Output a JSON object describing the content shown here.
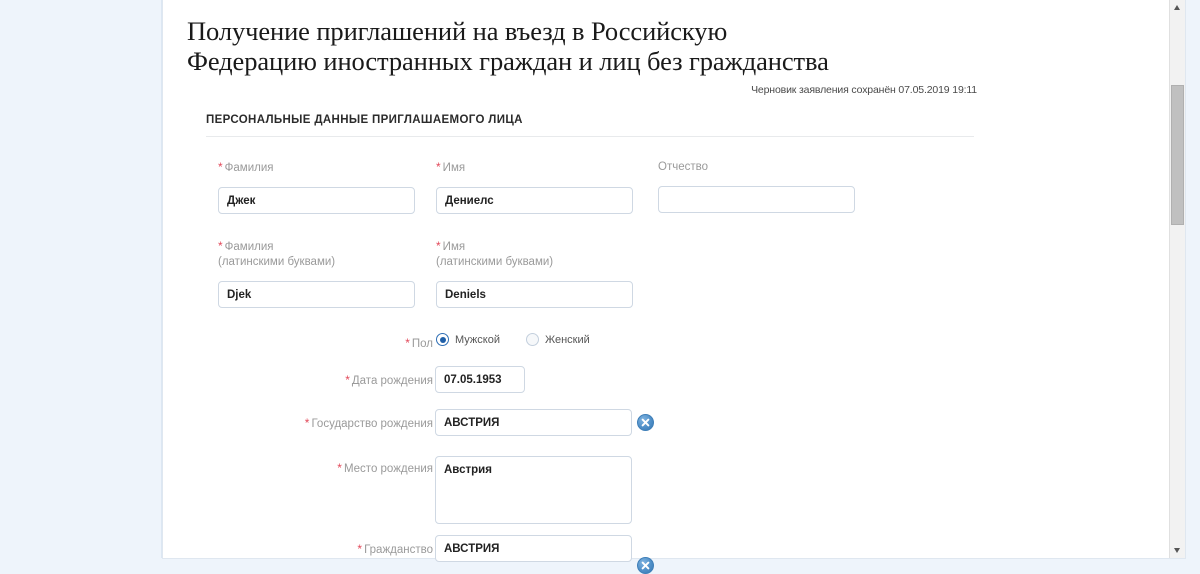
{
  "header": {
    "title": "Получение приглашений на въезд в Российскую\nФедерацию иностранных граждан и лиц без гражданства",
    "draft_note": "Черновик заявления сохранён 07.05.2019 19:11"
  },
  "section": {
    "title": "ПЕРСОНАЛЬНЫЕ ДАННЫЕ ПРИГЛАШАЕМОГО ЛИЦА"
  },
  "form": {
    "required_mark": "*",
    "surname": {
      "label": "Фамилия",
      "value": "Джек",
      "placeholder": ""
    },
    "name": {
      "label": "Имя",
      "value": "Дениелс",
      "placeholder": ""
    },
    "patronymic": {
      "label": "Отчество",
      "value": "",
      "placeholder": ""
    },
    "surname_latin": {
      "label": "Фамилия\n(латинскими буквами)",
      "value": "Djek",
      "placeholder": ""
    },
    "name_latin": {
      "label": "Имя\n(латинскими буквами)",
      "value": "Deniels",
      "placeholder": ""
    },
    "gender": {
      "label": "Пол",
      "selected": "male",
      "options": [
        {
          "id": "male",
          "label": "Мужской",
          "checked": true
        },
        {
          "id": "female",
          "label": "Женский",
          "checked": false
        }
      ]
    },
    "birth_date": {
      "label": "Дата рождения",
      "value": "07.05.1953",
      "placeholder": ""
    },
    "birth_country": {
      "label": "Государство рождения",
      "value": "АВСТРИЯ",
      "placeholder": "",
      "clear_title": "Очистить"
    },
    "birth_place": {
      "label": "Место рождения",
      "value": "Австрия",
      "placeholder": ""
    },
    "citizenship": {
      "label": "Гражданство",
      "value": "АВСТРИЯ",
      "placeholder": "",
      "clear_title": "Очистить"
    }
  },
  "colors": {
    "page_background": "#eef4fb",
    "sheet": "#ffffff",
    "required_asterisk": "#e2495a",
    "label_gray": "#9a9a9a",
    "input_border": "#cfd8e3",
    "clear_button_blue": "#4f8fc8",
    "radio_selected": "#1f5fa8"
  },
  "scrollbar": {
    "up_arrow": "scroll-up",
    "down_arrow": "scroll-down"
  }
}
